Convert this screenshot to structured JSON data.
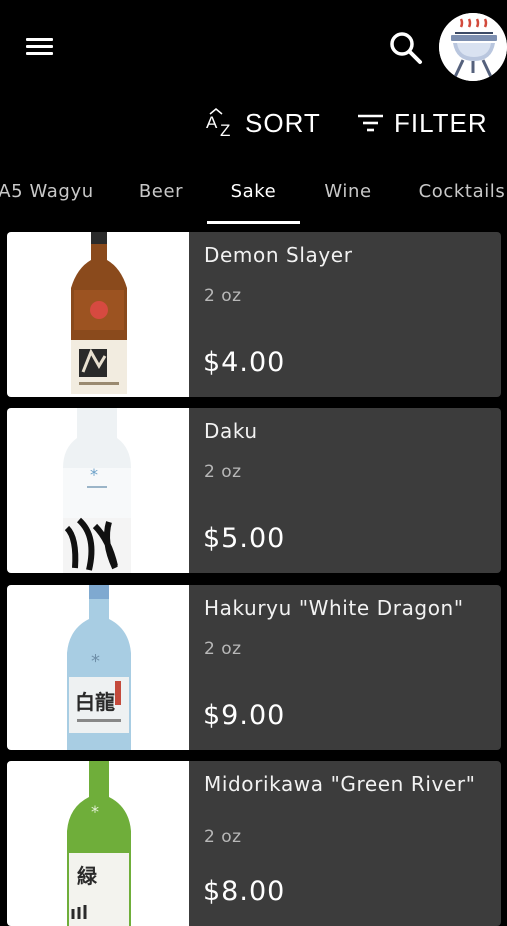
{
  "header": {
    "menu_icon": "hamburger-menu-icon",
    "search_icon": "search-icon",
    "avatar_icon": "grill-avatar"
  },
  "actions": {
    "sort_label": "SORT",
    "sort_icon_text": "AZ",
    "filter_label": "FILTER"
  },
  "tabs": [
    {
      "label": "A5 Wagyu",
      "active": false
    },
    {
      "label": "Beer",
      "active": false
    },
    {
      "label": "Sake",
      "active": true
    },
    {
      "label": "Wine",
      "active": false
    },
    {
      "label": "Cocktails",
      "active": false
    }
  ],
  "products": [
    {
      "name": "Demon Slayer",
      "size": "2 oz",
      "price": "$4.00",
      "bottle_color": "#8a4a1c"
    },
    {
      "name": "Daku",
      "size": "2 oz",
      "price": "$5.00",
      "bottle_color": "#eef2f4"
    },
    {
      "name": "Hakuryu \"White Dragon\"",
      "size": "2 oz",
      "price": "$9.00",
      "bottle_color": "#a8cde3"
    },
    {
      "name": "Midorikawa \"Green River\"",
      "size": "2 oz",
      "price": "$8.00",
      "bottle_color": "#6fae3a"
    }
  ],
  "colors": {
    "background": "#000000",
    "card": "#3c3c3c",
    "text": "#ffffff",
    "muted_text": "#b8b8b8"
  }
}
